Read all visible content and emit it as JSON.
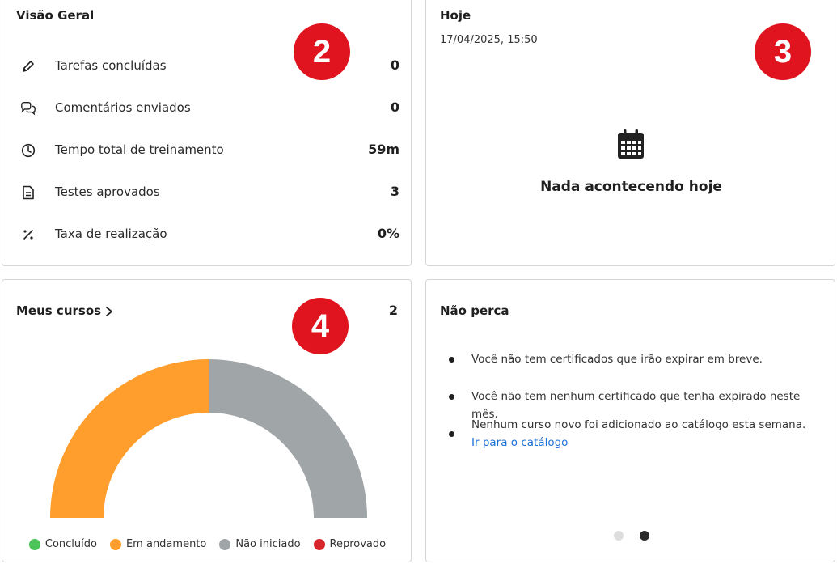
{
  "overview": {
    "title": "Visão Geral",
    "badge": "2",
    "rows": [
      {
        "icon": "pencil-icon",
        "label": "Tarefas concluídas",
        "value": "0"
      },
      {
        "icon": "comments-icon",
        "label": "Comentários enviados",
        "value": "0"
      },
      {
        "icon": "clock-icon",
        "label": "Tempo total de treinamento",
        "value": "59m"
      },
      {
        "icon": "document-icon",
        "label": "Testes aprovados",
        "value": "3"
      },
      {
        "icon": "percent-icon",
        "label": "Taxa de realização",
        "value": "0%"
      }
    ]
  },
  "today": {
    "title": "Hoje",
    "datetime": "17/04/2025, 15:50",
    "badge": "3",
    "empty_icon": "calendar-icon",
    "empty_text": "Nada acontecendo hoje"
  },
  "courses": {
    "title": "Meus cursos",
    "count": "2",
    "badge": "4",
    "chart_data": {
      "type": "pie",
      "style": "half-donut",
      "series": [
        {
          "name": "Concluído",
          "value": 0,
          "color": "#4cc45a"
        },
        {
          "name": "Em andamento",
          "value": 1,
          "color": "#ff9e2c"
        },
        {
          "name": "Não iniciado",
          "value": 1,
          "color": "#a0a5a7"
        },
        {
          "name": "Reprovado",
          "value": 0,
          "color": "#d7262b"
        }
      ]
    },
    "legend": [
      {
        "label": "Concluído",
        "color": "#4cc45a"
      },
      {
        "label": "Em andamento",
        "color": "#ff9e2c"
      },
      {
        "label": "Não iniciado",
        "color": "#a0a5a7"
      },
      {
        "label": "Reprovado",
        "color": "#d7262b"
      }
    ]
  },
  "dontmiss": {
    "title": "Não perca",
    "items": [
      {
        "text": "Você não tem certificados que irão expirar em breve."
      },
      {
        "text": "Você não tem nenhum certificado que tenha expirado neste mês."
      },
      {
        "text": "Nenhum curso novo foi adicionado ao catálogo esta semana.",
        "link": "Ir para o catálogo"
      }
    ],
    "pager": {
      "count": 2,
      "active": 2
    }
  },
  "colors": {
    "badge": "#e0141e",
    "link": "#1a6fd6"
  }
}
